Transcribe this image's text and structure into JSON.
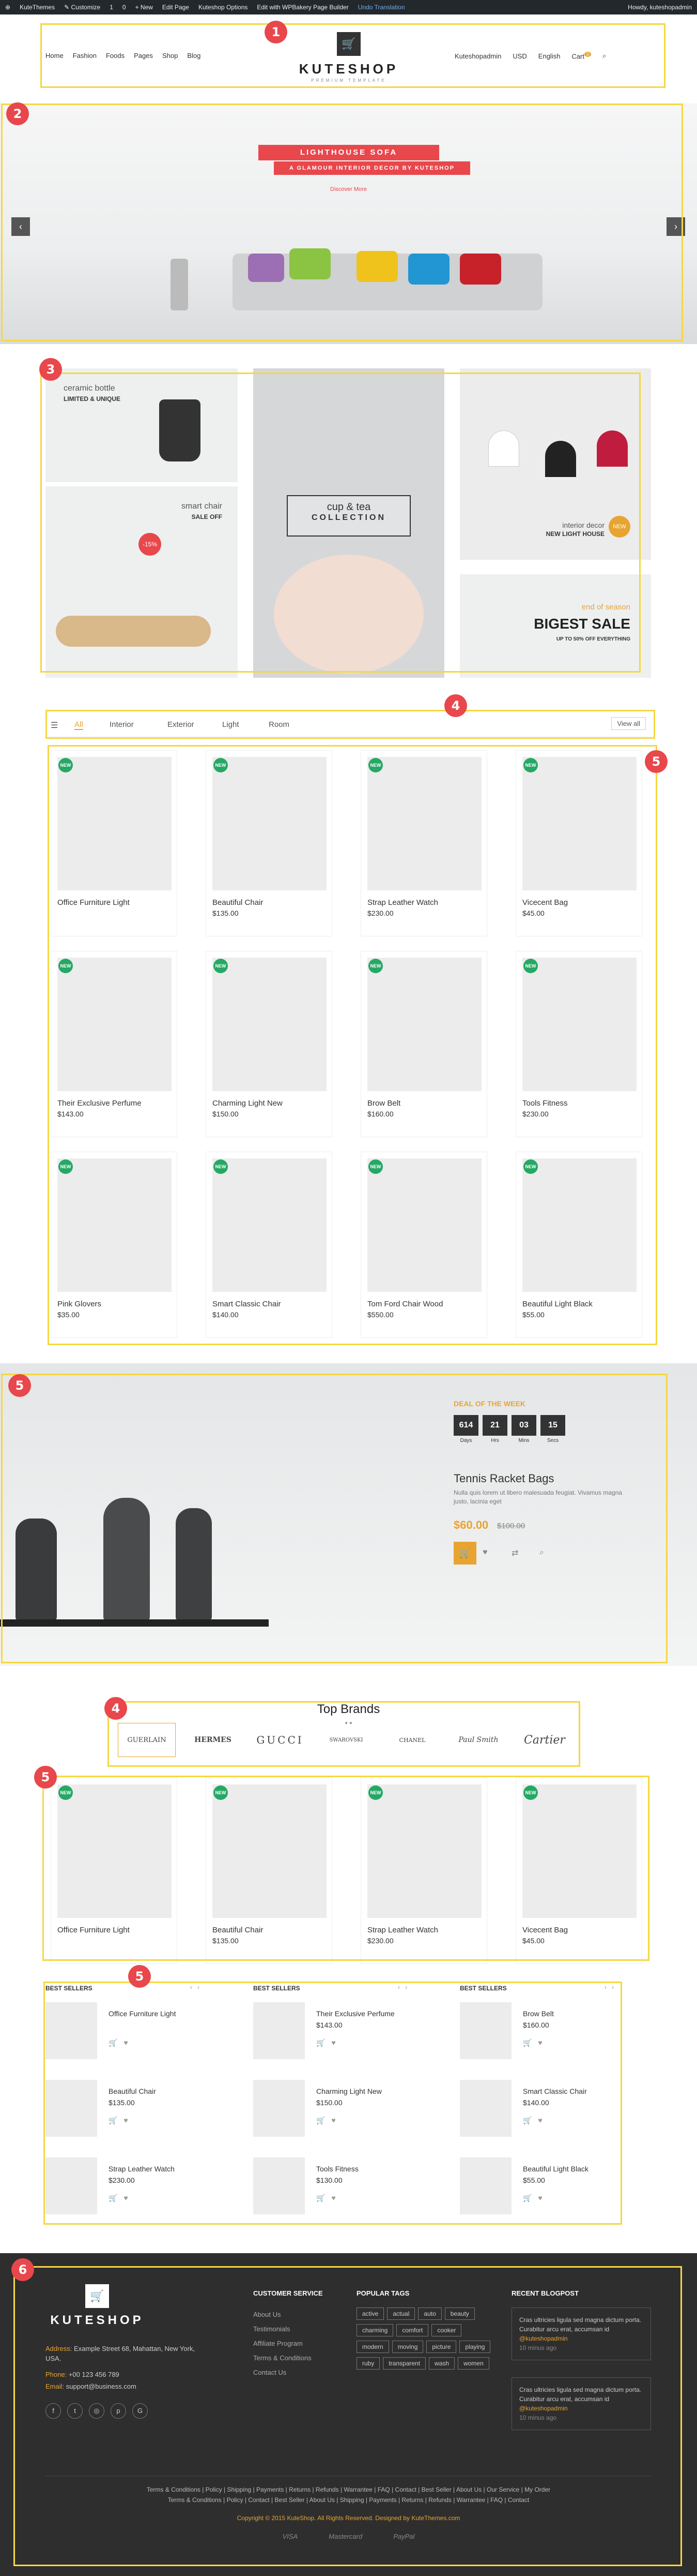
{
  "admin_bar": {
    "items": [
      "KuteThemes",
      "Customize",
      "1",
      "0",
      "+ New",
      "Edit Page",
      "Kuteshop Options",
      "Edit with WPBakery Page Builder",
      "Undo Translation"
    ],
    "greeting": "Howdy, kuteshopadmin"
  },
  "header": {
    "nav": [
      "Home",
      "Fashion",
      "Foods",
      "Pages",
      "Shop",
      "Blog"
    ],
    "logo": "KUTESHOP",
    "logo_sub": "PREMIUM TEMPLATE",
    "account": "Kuteshopadmin",
    "currency": "USD",
    "language": "English",
    "cart": "Cart",
    "cart_count": "0"
  },
  "hero": {
    "title": "LIGHTHOUSE SOFA",
    "subtitle": "A GLAMOUR INTERIOR DECOR BY KUTESHOP",
    "link": "Discover More"
  },
  "banners": {
    "b1": {
      "title": "ceramic bottle",
      "sub": "LIMITED & UNIQUE"
    },
    "b2": {
      "title": "smart chair",
      "sub": "SALE OFF",
      "badge": "-15%"
    },
    "b3": {
      "title": "cup & tea",
      "sub": "COLLECTION"
    },
    "b4": {
      "title": "interior decor",
      "sub": "NEW LIGHT HOUSE",
      "badge": "NEW"
    },
    "b5": {
      "title": "end of season",
      "sub": "BIGEST SALE",
      "note": "UP TO 50% OFF EVERYTHING"
    }
  },
  "tabs": {
    "items": [
      "All",
      "Interior",
      "Exterior",
      "Light",
      "Room"
    ],
    "view_all": "View all"
  },
  "badge_new": "NEW",
  "products": [
    {
      "name": "Office Furniture Light",
      "price": ""
    },
    {
      "name": "Beautiful Chair",
      "price": "$135.00"
    },
    {
      "name": "Strap Leather Watch",
      "price": "$230.00"
    },
    {
      "name": "Vicecent Bag",
      "price": "$45.00"
    },
    {
      "name": "Their Exclusive Perfume",
      "price": "$143.00"
    },
    {
      "name": "Charming Light New",
      "price": "$150.00"
    },
    {
      "name": "Brow Belt",
      "price": "$160.00"
    },
    {
      "name": "Tools Fitness",
      "price": "$230.00"
    },
    {
      "name": "Pink Glovers",
      "price": "$35.00"
    },
    {
      "name": "Smart Classic Chair",
      "price": "$140.00"
    },
    {
      "name": "Tom Ford Chair Wood",
      "price": "$550.00"
    },
    {
      "name": "Beautiful Light Black",
      "price": "$55.00"
    }
  ],
  "deal": {
    "label": "DEAL OF THE WEEK",
    "countdown": [
      {
        "v": "614",
        "l": "Days"
      },
      {
        "v": "21",
        "l": "Hrs"
      },
      {
        "v": "03",
        "l": "Mins"
      },
      {
        "v": "15",
        "l": "Secs"
      }
    ],
    "name": "Tennis Racket Bags",
    "desc": "Nulla quis lorem ut libero malesuada feugiat. Vivamus magna justo, lacinia eget",
    "price": "$60.00",
    "old_price": "$100.00"
  },
  "brands": {
    "title": "Top Brands",
    "items": [
      "GUERLAIN",
      "HERMES",
      "GUCCI",
      "SWAROVSKI",
      "CHANEL",
      "Paul Smith",
      "Cartier"
    ]
  },
  "products2": [
    {
      "name": "Office Furniture Light",
      "price": ""
    },
    {
      "name": "Beautiful Chair",
      "price": "$135.00"
    },
    {
      "name": "Strap Leather Watch",
      "price": "$230.00"
    },
    {
      "name": "Vicecent Bag",
      "price": "$45.00"
    }
  ],
  "best_sellers": {
    "title": "BEST SELLERS",
    "columns": [
      [
        {
          "name": "Office Furniture Light",
          "price": ""
        },
        {
          "name": "Beautiful Chair",
          "price": "$135.00"
        },
        {
          "name": "Strap Leather Watch",
          "price": "$230.00"
        }
      ],
      [
        {
          "name": "Their Exclusive Perfume",
          "price": "$143.00"
        },
        {
          "name": "Charming Light New",
          "price": "$150.00"
        },
        {
          "name": "Tools Fitness",
          "price": "$130.00"
        }
      ],
      [
        {
          "name": "Brow Belt",
          "price": "$160.00"
        },
        {
          "name": "Smart Classic Chair",
          "price": "$140.00"
        },
        {
          "name": "Beautiful Light Black",
          "price": "$55.00"
        }
      ]
    ]
  },
  "footer": {
    "logo": "KUTESHOP",
    "address_label": "Address:",
    "address": "Example Street 68, Mahattan, New York, USA.",
    "phone_label": "Phone:",
    "phone": "+00 123 456 789",
    "email_label": "Email:",
    "email": "support@business.com",
    "cs_title": "CUSTOMER SERVICE",
    "cs_links": [
      "About Us",
      "Testimonials",
      "Affiliate Program",
      "Terms & Conditions",
      "Contact Us"
    ],
    "tags_title": "POPULAR TAGS",
    "tags": [
      "active",
      "actual",
      "auto",
      "beauty",
      "charming",
      "comfort",
      "cooker",
      "modern",
      "moving",
      "picture",
      "playing",
      "ruby",
      "transparent",
      "wash",
      "women"
    ],
    "blog_title": "RECENT BLOGPOST",
    "blog_text": "Cras ultricies ligula sed magna dictum porta. Curabitur arcu erat, accumsan id",
    "blog_author": "@kuteshopadmin",
    "blog_time": "10 minus ago",
    "links_row1": "Terms & Conditions | Policy | Shipping | Payments | Returns | Refunds | Warrantee | FAQ | Contact | Best Seller | About Us | Our Service | My Order",
    "links_row2": "Terms & Conditions | Policy | Contact | Best Seller | About Us | Shipping | Payments | Returns | Refunds | Warrantee | FAQ | Contact",
    "copyright": "Copyright © 2015 KuteShop. All Rights Reserved. Designed by KuteThemes.com",
    "payments": [
      "VISA",
      "Mastercard",
      "PayPal"
    ]
  },
  "annotations": [
    "1",
    "2",
    "3",
    "4",
    "5",
    "5",
    "4",
    "5",
    "5",
    "6"
  ]
}
